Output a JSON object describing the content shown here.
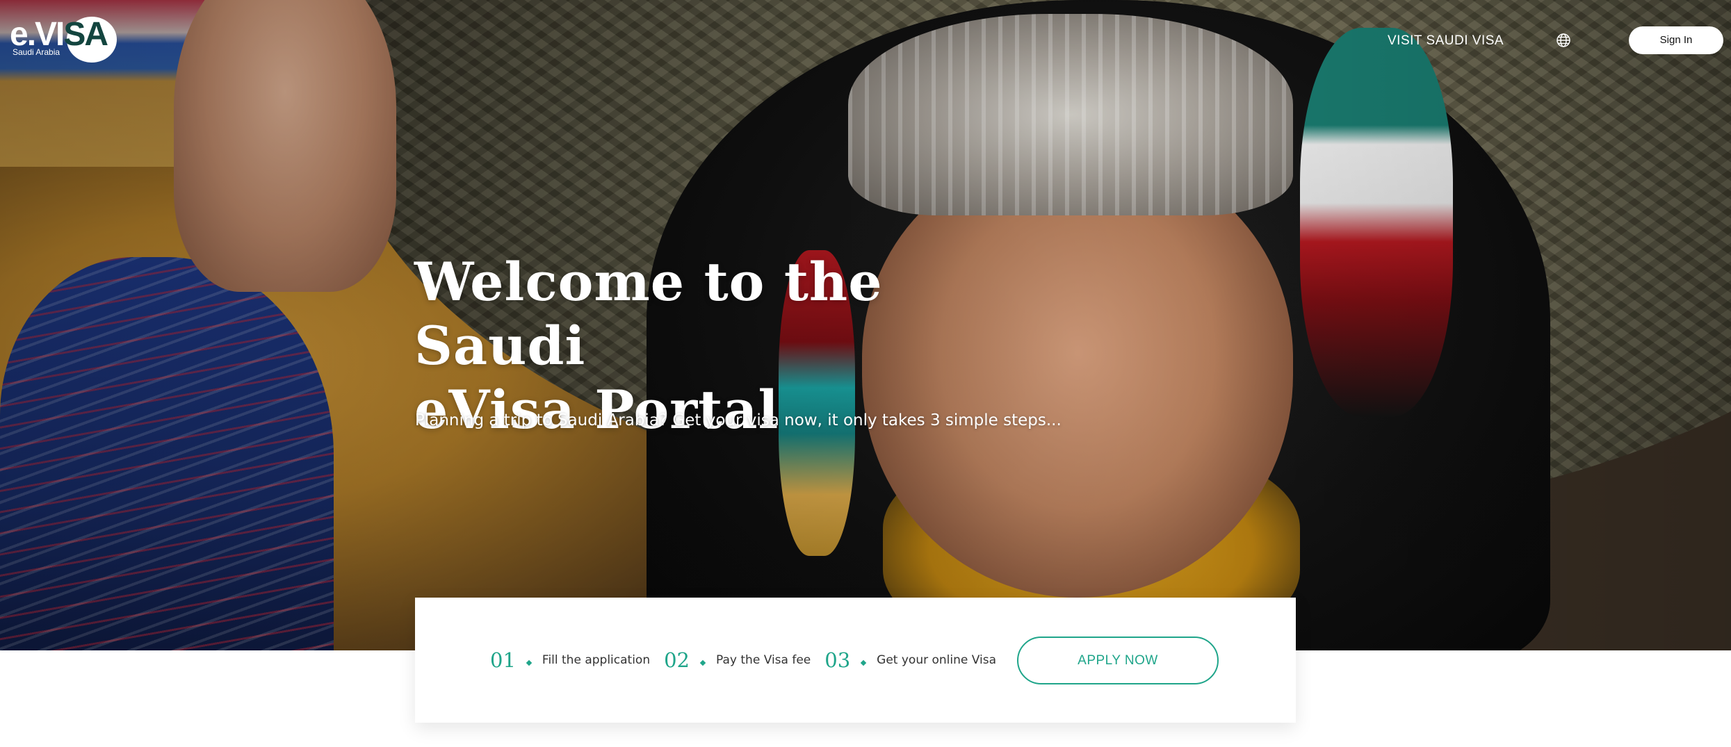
{
  "header": {
    "logo": {
      "wordmark_prefix": "e.VI",
      "wordmark_suffix": "SA",
      "subtitle": "Saudi Arabia"
    },
    "nav_link": "VISIT SAUDI VISA",
    "language_icon": "globe-icon",
    "signin_label": "Sign In"
  },
  "hero": {
    "title_line1": "Welcome to the Saudi",
    "title_line2": "eVisa Portal",
    "subtitle": "Planning a trip to Saudi Arabia? Get your visa now, it only takes 3 simple steps..."
  },
  "steps": [
    {
      "number": "01",
      "label": "Fill the application"
    },
    {
      "number": "02",
      "label": "Pay the Visa fee"
    },
    {
      "number": "03",
      "label": "Get your online Visa"
    }
  ],
  "cta": {
    "apply_label": "APPLY NOW"
  },
  "colors": {
    "accent": "#1fa58a",
    "logo_dark": "#13453f",
    "white": "#ffffff"
  }
}
